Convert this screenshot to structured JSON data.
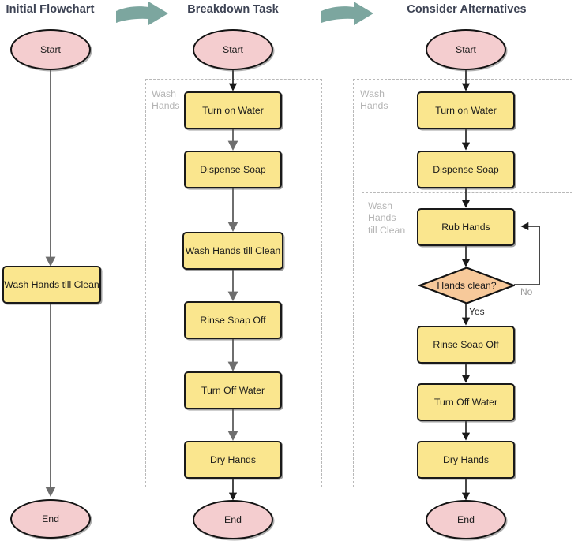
{
  "diagram": {
    "title_color": "#3d4354",
    "palette": {
      "process_fill": "#fae68e",
      "terminator_fill": "#f4cdcf",
      "decision_fill": "#f7c99a",
      "group_stroke": "#b9b9b9",
      "group_label": "#b4b4b4",
      "arrow_graphic": "#7ca69f",
      "connector_col1": "#6e6e6e",
      "connector_col2": "#6e6e6e",
      "connector_col3": "#1a1a1a"
    },
    "columns": [
      {
        "id": "initial-flowchart",
        "title": "Initial Flowchart",
        "nodes": [
          {
            "id": "c1-start",
            "type": "terminator",
            "label": "Start"
          },
          {
            "id": "c1-wash",
            "type": "process",
            "label": "Wash Hands till Clean"
          },
          {
            "id": "c1-end",
            "type": "terminator",
            "label": "End"
          }
        ],
        "groups": [],
        "edge_labels": []
      },
      {
        "id": "breakdown-task",
        "title": "Breakdown Task",
        "nodes": [
          {
            "id": "c2-start",
            "type": "terminator",
            "label": "Start"
          },
          {
            "id": "c2-turn-on-water",
            "type": "process",
            "label": "Turn on Water"
          },
          {
            "id": "c2-dispense-soap",
            "type": "process",
            "label": "Dispense Soap"
          },
          {
            "id": "c2-wash-hands-till-clean",
            "type": "process",
            "label": "Wash Hands till Clean"
          },
          {
            "id": "c2-rinse-soap-off",
            "type": "process",
            "label": "Rinse Soap Off"
          },
          {
            "id": "c2-turn-off-water",
            "type": "process",
            "label": "Turn Off Water"
          },
          {
            "id": "c2-dry-hands",
            "type": "process",
            "label": "Dry Hands"
          },
          {
            "id": "c2-end",
            "type": "terminator",
            "label": "End"
          }
        ],
        "groups": [
          {
            "id": "c2-group-wash-hands",
            "label": "Wash\nHands"
          }
        ],
        "edge_labels": []
      },
      {
        "id": "consider-alternatives",
        "title": "Consider Alternatives",
        "nodes": [
          {
            "id": "c3-start",
            "type": "terminator",
            "label": "Start"
          },
          {
            "id": "c3-turn-on-water",
            "type": "process",
            "label": "Turn on Water"
          },
          {
            "id": "c3-dispense-soap",
            "type": "process",
            "label": "Dispense Soap"
          },
          {
            "id": "c3-rub-hands",
            "type": "process",
            "label": "Rub Hands"
          },
          {
            "id": "c3-hands-clean",
            "type": "decision",
            "label": "Hands clean?"
          },
          {
            "id": "c3-rinse-soap-off",
            "type": "process",
            "label": "Rinse Soap Off"
          },
          {
            "id": "c3-turn-off-water",
            "type": "process",
            "label": "Turn Off Water"
          },
          {
            "id": "c3-dry-hands",
            "type": "process",
            "label": "Dry Hands"
          },
          {
            "id": "c3-end",
            "type": "terminator",
            "label": "End"
          }
        ],
        "groups": [
          {
            "id": "c3-group-wash-hands",
            "label": "Wash\nHands"
          },
          {
            "id": "c3-group-wash-till-clean",
            "label": "Wash\nHands\ntill Clean"
          }
        ],
        "edge_labels": [
          {
            "id": "c3-edge-yes",
            "label": "Yes"
          },
          {
            "id": "c3-edge-no",
            "label": "No"
          }
        ]
      }
    ],
    "transitions": [
      {
        "id": "transition-arrow-1",
        "icon": "curved-right-arrow-icon"
      },
      {
        "id": "transition-arrow-2",
        "icon": "curved-right-arrow-icon"
      }
    ]
  }
}
